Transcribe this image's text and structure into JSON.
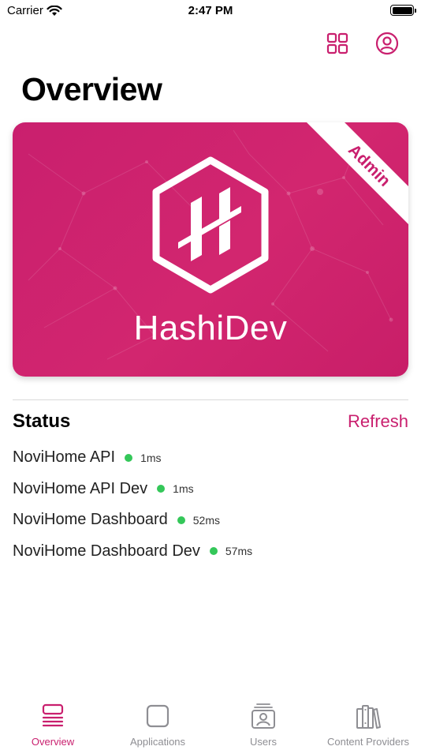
{
  "status_bar": {
    "carrier": "Carrier",
    "time": "2:47 PM"
  },
  "header": {
    "title": "Overview",
    "icons": [
      "grid-icon",
      "profile-icon"
    ]
  },
  "card": {
    "brand_part1": "Hashi",
    "brand_part2": "Dev",
    "role_badge": "Admin",
    "color": "#c91f6e"
  },
  "status": {
    "title": "Status",
    "refresh_label": "Refresh",
    "online_color": "#34c759",
    "services": [
      {
        "name": "NoviHome API",
        "latency": "1ms"
      },
      {
        "name": "NoviHome API Dev",
        "latency": "1ms"
      },
      {
        "name": "NoviHome Dashboard",
        "latency": "52ms"
      },
      {
        "name": "NoviHome Dashboard Dev",
        "latency": "57ms"
      }
    ]
  },
  "tabbar": {
    "active_color": "#c91f6e",
    "inactive_color": "#8e8e93",
    "tabs": [
      {
        "label": "Overview",
        "icon": "list-icon",
        "active": true
      },
      {
        "label": "Applications",
        "icon": "square-icon",
        "active": false
      },
      {
        "label": "Users",
        "icon": "users-icon",
        "active": false
      },
      {
        "label": "Content Providers",
        "icon": "books-icon",
        "active": false
      }
    ]
  }
}
